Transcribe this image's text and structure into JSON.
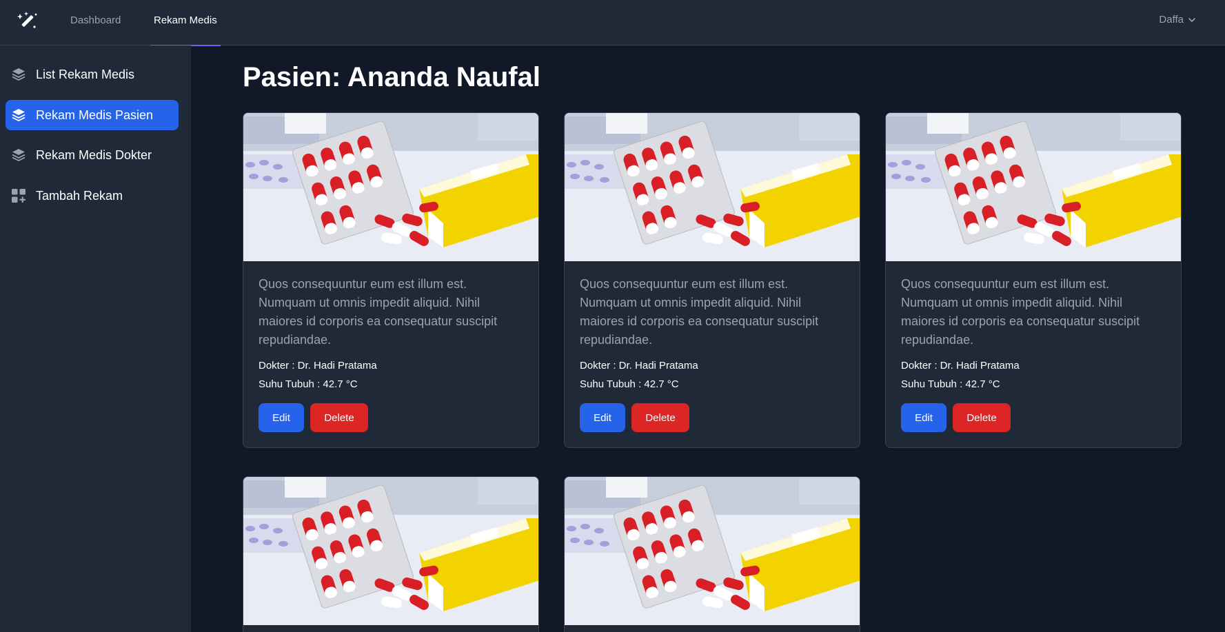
{
  "nav": {
    "links": [
      {
        "label": "Dashboard",
        "active": false
      },
      {
        "label": "Rekam Medis",
        "active": true
      }
    ],
    "user": "Daffa"
  },
  "sidebar": {
    "items": [
      {
        "label": "List Rekam Medis",
        "icon": "layers-icon",
        "active": false
      },
      {
        "label": "Rekam Medis Pasien",
        "icon": "layers-icon",
        "active": true
      },
      {
        "label": "Rekam Medis Dokter",
        "icon": "layers-icon",
        "active": false
      },
      {
        "label": "Tambah Rekam",
        "icon": "grid-plus-icon",
        "active": false
      }
    ]
  },
  "page": {
    "title": "Pasien: Ananda Naufal"
  },
  "cards": [
    {
      "description": "Quos consequuntur eum est illum est. Numquam ut omnis impedit aliquid. Nihil maiores id corporis ea consequatur suscipit repudiandae.",
      "doctor": "Dokter : Dr. Hadi Pratama",
      "temperature": "Suhu Tubuh : 42.7 °C",
      "edit_label": "Edit",
      "delete_label": "Delete"
    },
    {
      "description": "Quos consequuntur eum est illum est. Numquam ut omnis impedit aliquid. Nihil maiores id corporis ea consequatur suscipit repudiandae.",
      "doctor": "Dokter : Dr. Hadi Pratama",
      "temperature": "Suhu Tubuh : 42.7 °C",
      "edit_label": "Edit",
      "delete_label": "Delete"
    },
    {
      "description": "Quos consequuntur eum est illum est. Numquam ut omnis impedit aliquid. Nihil maiores id corporis ea consequatur suscipit repudiandae.",
      "doctor": "Dokter : Dr. Hadi Pratama",
      "temperature": "Suhu Tubuh : 42.7 °C",
      "edit_label": "Edit",
      "delete_label": "Delete"
    },
    {
      "description": "",
      "doctor": "",
      "temperature": "",
      "edit_label": "",
      "delete_label": ""
    },
    {
      "description": "",
      "doctor": "",
      "temperature": "",
      "edit_label": "",
      "delete_label": ""
    }
  ],
  "colors": {
    "accent": "#2563eb",
    "danger": "#dc2626",
    "nav_indicator": "#6366f1"
  }
}
